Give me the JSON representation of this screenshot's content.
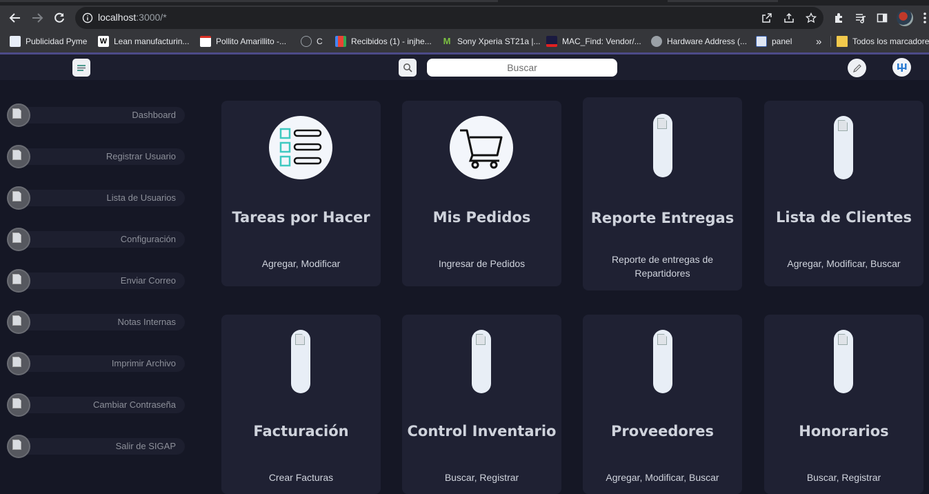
{
  "browser": {
    "url_host": "localhost",
    "url_rest": ":3000/*",
    "bookmarks": [
      {
        "label": "Publicidad Pyme"
      },
      {
        "label": "Lean manufacturin..."
      },
      {
        "label": "Pollito Amarillito -..."
      },
      {
        "label": "C"
      },
      {
        "label": "Recibidos (1) - injhe..."
      },
      {
        "label": "Sony Xperia ST21a |..."
      },
      {
        "label": "MAC_Find: Vendor/..."
      },
      {
        "label": "Hardware Address (..."
      },
      {
        "label": "panel"
      },
      {
        "label": "Todos los marcadores"
      }
    ],
    "more_bookmarks": "»"
  },
  "header": {
    "search_placeholder": "Buscar"
  },
  "sidebar": {
    "items": [
      {
        "label": "Dashboard"
      },
      {
        "label": "Registrar Usuario"
      },
      {
        "label": "Lista de Usuarios"
      },
      {
        "label": "Configuración"
      },
      {
        "label": "Enviar Correo"
      },
      {
        "label": "Notas Internas"
      },
      {
        "label": "Imprimir Archivo"
      },
      {
        "label": "Cambiar Contraseña"
      },
      {
        "label": "Salir de SIGAP"
      }
    ]
  },
  "cards": [
    {
      "title": "Tareas por Hacer",
      "desc": "Agregar, Modificar",
      "icon": "checklist-icon"
    },
    {
      "title": "Mis Pedidos",
      "desc": "Ingresar de Pedidos",
      "icon": "shopping-cart-icon"
    },
    {
      "title": "Reporte Entregas",
      "desc": "Reporte de entregas de Repartidores",
      "icon": "broken-image-icon"
    },
    {
      "title": "Lista de Clientes",
      "desc": "Agregar, Modificar, Buscar",
      "icon": "broken-image-icon"
    },
    {
      "title": "Facturación",
      "desc": "Crear Facturas",
      "icon": "broken-image-icon"
    },
    {
      "title": "Control Inventario",
      "desc": "Buscar, Registrar",
      "icon": "broken-image-icon"
    },
    {
      "title": "Proveedores",
      "desc": "Agregar, Modificar, Buscar",
      "icon": "broken-image-icon"
    },
    {
      "title": "Honorarios",
      "desc": "Buscar, Registrar",
      "icon": "broken-image-icon"
    }
  ],
  "colors": {
    "background": "#151725",
    "card": "#1f2133",
    "sidebar_pill": "#1d1f2f",
    "accent_checklist": "#3fc9c1"
  }
}
